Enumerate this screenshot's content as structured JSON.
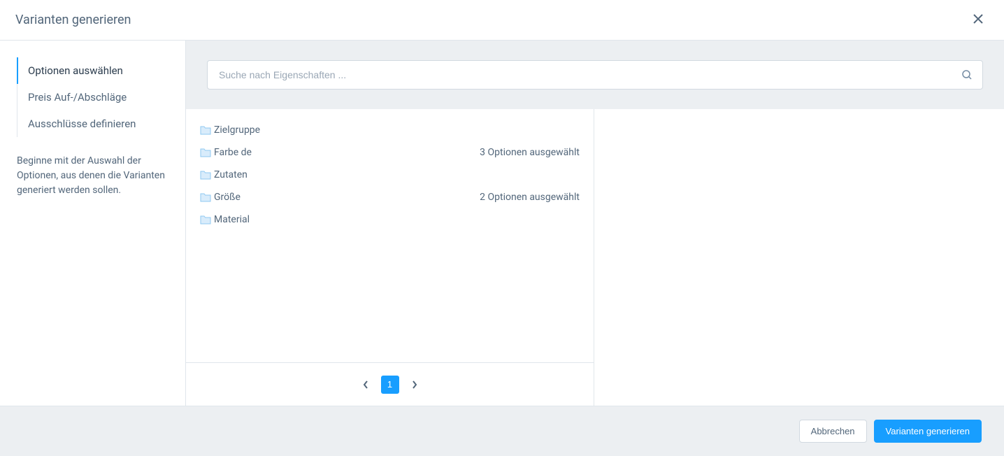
{
  "header": {
    "title": "Varianten generieren"
  },
  "sidebar": {
    "tabs": [
      {
        "label": "Optionen auswählen",
        "active": true
      },
      {
        "label": "Preis Auf-/Abschläge",
        "active": false
      },
      {
        "label": "Ausschlüsse definieren",
        "active": false
      }
    ],
    "help_text": "Beginne mit der Auswahl der Optionen, aus denen die Varianten generiert werden sollen."
  },
  "search": {
    "placeholder": "Suche nach Eigenschaften ..."
  },
  "properties": [
    {
      "name": "Zielgruppe",
      "selected_text": ""
    },
    {
      "name": "Farbe de",
      "selected_text": "3 Optionen ausgewählt"
    },
    {
      "name": "Zutaten",
      "selected_text": ""
    },
    {
      "name": "Größe",
      "selected_text": "2 Optionen ausgewählt"
    },
    {
      "name": "Material",
      "selected_text": ""
    }
  ],
  "pagination": {
    "current": "1"
  },
  "footer": {
    "cancel_label": "Abbrechen",
    "generate_label": "Varianten generieren"
  }
}
